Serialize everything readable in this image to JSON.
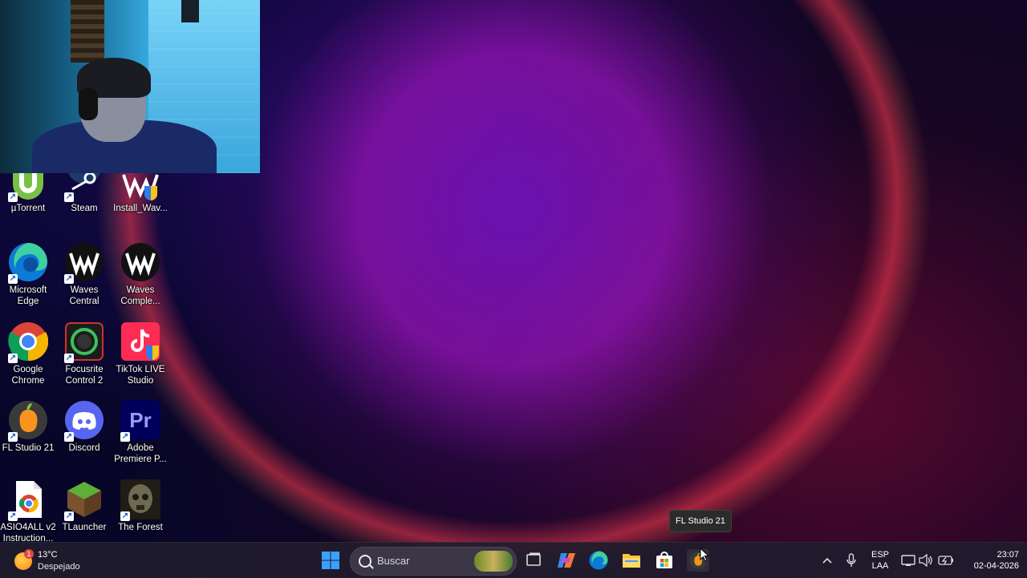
{
  "desktop": {
    "icons": [
      {
        "label": "µTorrent",
        "icon": "utorrent-icon"
      },
      {
        "label": "Steam",
        "icon": "steam-icon"
      },
      {
        "label": "Install_Wav...",
        "icon": "waves-installer-icon"
      },
      {
        "label": "Microsoft Edge",
        "icon": "edge-icon"
      },
      {
        "label": "Waves Central",
        "icon": "waves-icon"
      },
      {
        "label": "Waves Comple...",
        "icon": "waves-icon"
      },
      {
        "label": "Google Chrome",
        "icon": "chrome-icon"
      },
      {
        "label": "Focusrite Control 2",
        "icon": "focusrite-icon"
      },
      {
        "label": "TikTok LIVE Studio",
        "icon": "tiktok-icon"
      },
      {
        "label": "FL Studio 21",
        "icon": "fl-studio-icon"
      },
      {
        "label": "Discord",
        "icon": "discord-icon"
      },
      {
        "label": "Adobe Premiere P...",
        "icon": "premiere-icon"
      },
      {
        "label": "ASIO4ALL v2 Instruction...",
        "icon": "chrome-document-icon"
      },
      {
        "label": "TLauncher",
        "icon": "tlauncher-icon"
      },
      {
        "label": "The Forest",
        "icon": "the-forest-icon"
      }
    ],
    "premiere_glyph": "Pr"
  },
  "tooltip": {
    "text": "FL Studio 21"
  },
  "taskbar": {
    "weather": {
      "temp": "13°C",
      "condition": "Despejado",
      "badge": "1"
    },
    "search_placeholder": "Buscar",
    "tray": {
      "lang_line1": "ESP",
      "lang_line2": "LAA",
      "time": "23:07",
      "date": "02-04-2026"
    }
  },
  "colors": {
    "taskbar_bg": "#201c2c",
    "accent_windows": "#3aa0ff",
    "tooltip_bg": "#2b2b2b"
  }
}
